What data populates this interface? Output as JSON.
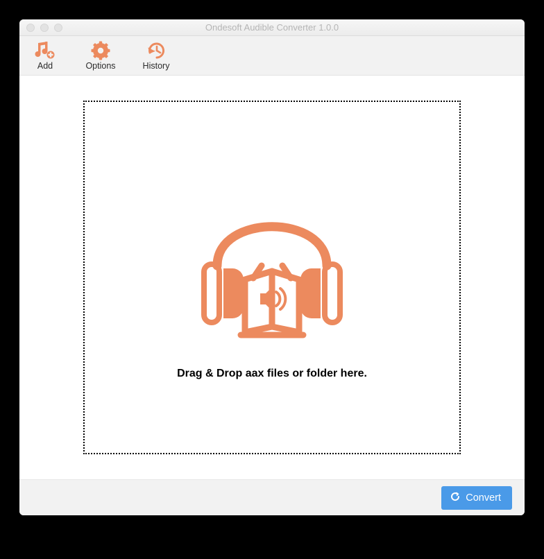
{
  "window": {
    "title": "Ondesoft Audible Converter 1.0.0"
  },
  "toolbar": {
    "add_label": "Add",
    "options_label": "Options",
    "history_label": "History"
  },
  "dropzone": {
    "instruction": "Drag & Drop aax files or folder here."
  },
  "footer": {
    "convert_label": "Convert"
  },
  "colors": {
    "accent_orange": "#ec8a5e",
    "button_blue": "#4a9ae8"
  }
}
